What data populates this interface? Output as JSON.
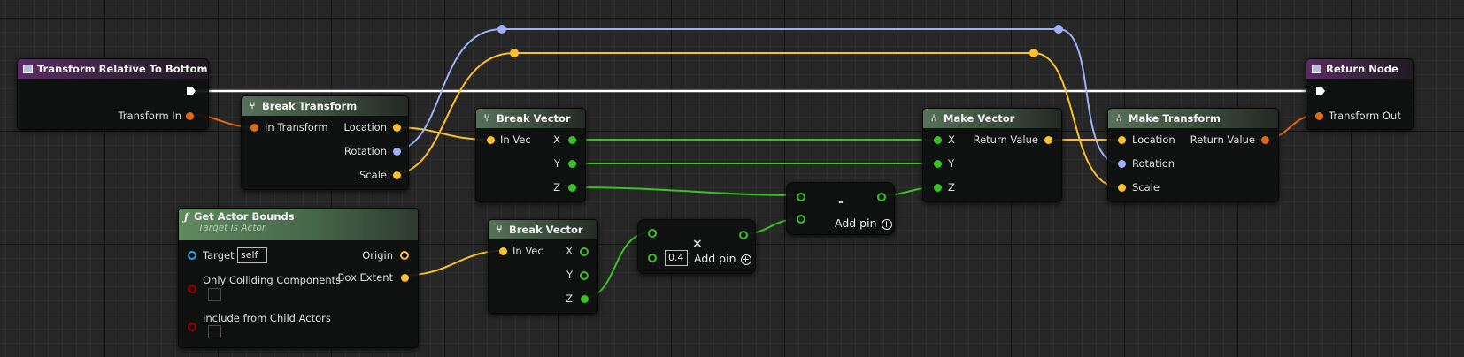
{
  "nodes": {
    "transform_relative": {
      "title": "Transform Relative To Bottom",
      "out_pin": "Transform In"
    },
    "break_transform": {
      "title": "Break Transform",
      "in_pin": "In Transform",
      "outs": [
        "Location",
        "Rotation",
        "Scale"
      ]
    },
    "break_vector_1": {
      "title": "Break Vector",
      "in_pin": "In Vec",
      "outs": [
        "X",
        "Y",
        "Z"
      ]
    },
    "get_actor_bounds": {
      "title": "Get Actor Bounds",
      "subtitle": "Target is Actor",
      "target": "Target",
      "target_value": "self",
      "only_colliding": "Only Colliding Components",
      "include_children": "Include from Child Actors",
      "origin": "Origin",
      "box_extent": "Box Extent"
    },
    "break_vector_2": {
      "title": "Break Vector",
      "in_pin": "In Vec",
      "outs": [
        "X",
        "Y",
        "Z"
      ]
    },
    "multiply": {
      "symbol": "×",
      "value": "0.4",
      "add_pin": "Add pin"
    },
    "subtract": {
      "symbol": "-",
      "add_pin": "Add pin"
    },
    "make_vector": {
      "title": "Make Vector",
      "ins": [
        "X",
        "Y",
        "Z"
      ],
      "out_pin": "Return Value"
    },
    "make_transform": {
      "title": "Make Transform",
      "ins": [
        "Location",
        "Rotation",
        "Scale"
      ],
      "out_pin": "Return Value"
    },
    "return_node": {
      "title": "Return Node",
      "in_pin": "Transform Out"
    }
  },
  "colors": {
    "transform_pin": "#e06a14",
    "vector_pin": "#fbc02d",
    "rotator_pin": "#9fb1f5",
    "float_pin": "#39c126",
    "object_pin": "#2aa6e0",
    "bool_pin": "#a00000",
    "exec_wire": "#ffffff"
  }
}
